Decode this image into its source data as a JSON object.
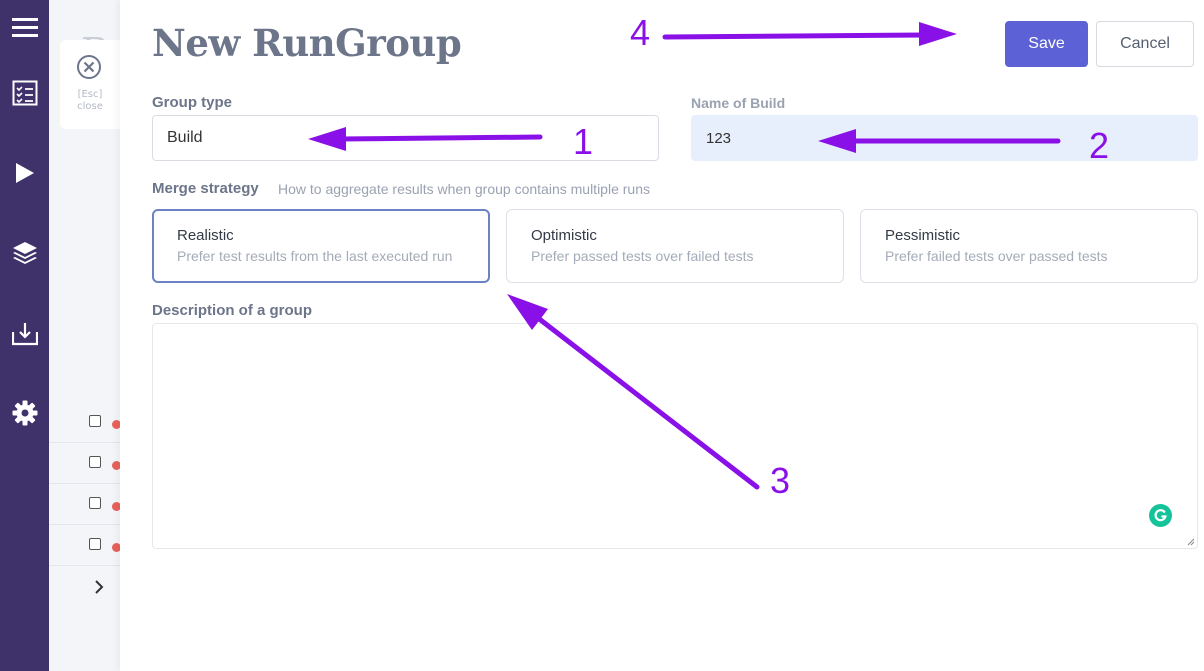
{
  "sidebar": {
    "items": [
      {
        "icon": "hamburger-menu-icon"
      },
      {
        "icon": "checklist-icon"
      },
      {
        "icon": "play-icon"
      },
      {
        "icon": "layers-icon"
      },
      {
        "icon": "download-tray-icon"
      },
      {
        "icon": "gear-icon"
      }
    ]
  },
  "background": {
    "title": "Ru",
    "close_hint_key": "[Esc]",
    "close_hint_label": "close"
  },
  "panel": {
    "title": "New RunGroup",
    "save_label": "Save",
    "cancel_label": "Cancel"
  },
  "form": {
    "group_type": {
      "label": "Group type",
      "value": "Build"
    },
    "build_name": {
      "label": "Name of Build",
      "value": "123"
    },
    "merge_strategy": {
      "label": "Merge strategy",
      "hint": "How to aggregate results when group contains multiple runs",
      "selected": "Realistic",
      "options": [
        {
          "title": "Realistic",
          "description": "Prefer test results from the last executed run"
        },
        {
          "title": "Optimistic",
          "description": "Prefer passed tests over failed tests"
        },
        {
          "title": "Pessimistic",
          "description": "Prefer failed tests over passed tests"
        }
      ]
    },
    "description": {
      "label": "Description of a group",
      "value": ""
    }
  },
  "annotations": {
    "numbers": [
      "1",
      "2",
      "3",
      "4"
    ],
    "color": "#8a10e8"
  },
  "colors": {
    "sidebar": "#3f3169",
    "primary_button": "#5c62d6",
    "selected_border": "#6b82c4",
    "status_dot": "#e8625b",
    "grammarly": "#15c39a"
  }
}
